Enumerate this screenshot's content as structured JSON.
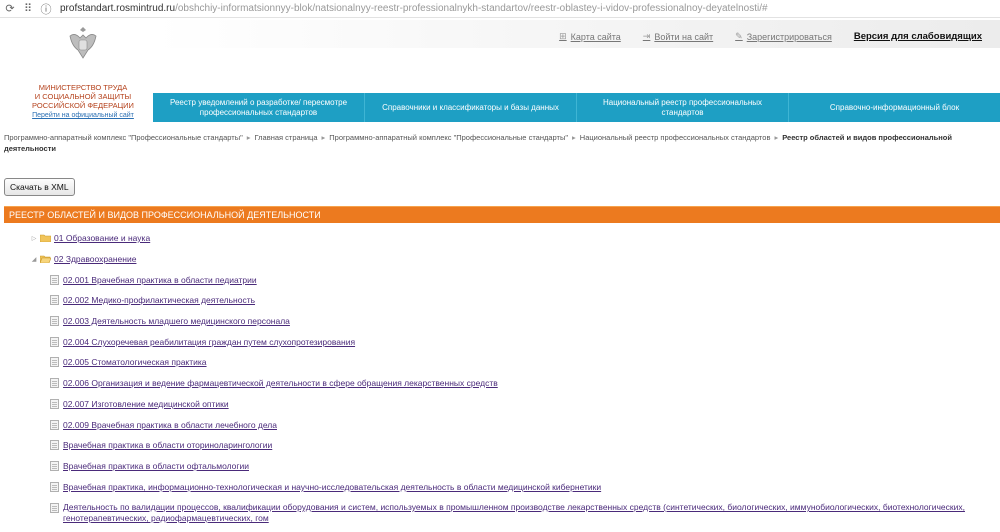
{
  "browser": {
    "url_host": "profstandart.rosmintrud.ru",
    "url_path": "/obshchiy-informatsionnyy-blok/natsionalnyy-reestr-professionalnykh-standartov/reestr-oblastey-i-vidov-professionalnoy-deyatelnosti/#"
  },
  "header": {
    "ministry_lines": [
      "МИНИСТЕРСТВО ТРУДА",
      "И СОЦИАЛЬНОЙ ЗАЩИТЫ",
      "РОССИЙСКОЙ ФЕДЕРАЦИИ"
    ],
    "official_link": "Перейти на официальный сайт",
    "links": {
      "sitemap": "Карта сайта",
      "login": "Войти на сайт",
      "register": "Зарегистрироваться",
      "accessible": "Версия для слабовидящих"
    }
  },
  "menu": [
    "Реестр уведомлений о разработке/ пересмотре профессиональных стандартов",
    "Справочники и классификаторы и базы данных",
    "Национальный реестр профессиональных стандартов",
    "Справочно-информационный блок"
  ],
  "breadcrumb": [
    "Программно-аппаратный комплекс \"Профессиональные стандарты\"",
    "Главная страница",
    "Программно-аппаратный комплекс \"Профессиональные стандарты\"",
    "Национальный реестр профессиональных стандартов"
  ],
  "breadcrumb_current": "Реестр областей и видов профессиональной деятельности",
  "xml_button": "Скачать в XML",
  "panel_title": "Реестр областей и видов профессиональной деятельности",
  "tree": {
    "folders": [
      {
        "label": "01 Образование и наука",
        "expanded": false
      },
      {
        "label": "02 Здравоохранение",
        "expanded": true
      }
    ],
    "items": [
      "02.001 Врачебная практика в области педиатрии",
      "02.002 Медико-профилактическая деятельность",
      "02.003 Деятельность младшего медицинского персонала",
      "02.004 Слухоречевая реабилитация граждан путем слухопротезирования",
      "02.005 Стоматологическая практика",
      "02.006 Организация и ведение фармацевтической деятельности в сфере обращения лекарственных средств",
      "02.007 Изготовление медицинской оптики",
      "02.009 Врачебная практика в области лечебного дела",
      "Врачебная практика в области оториноларингологии",
      "Врачебная практика в области офтальмологии",
      "Врачебная практика, информационно-технологическая и научно-исследовательская деятельность в области медицинской кибернетики",
      "Деятельность по валидации процессов, квалификации оборудования и систем, используемых в промышленном производстве лекарственных средств (синтетических, биологических, иммунобиологических, биотехнологических, генотерапевтических, радиофармацевтических, гом"
    ]
  },
  "colors": {
    "menu_blue": "#1e9fc4",
    "panel_orange": "#ec7a1f",
    "ministry_red": "#b4401a",
    "link_purple": "#4a2a7a"
  }
}
